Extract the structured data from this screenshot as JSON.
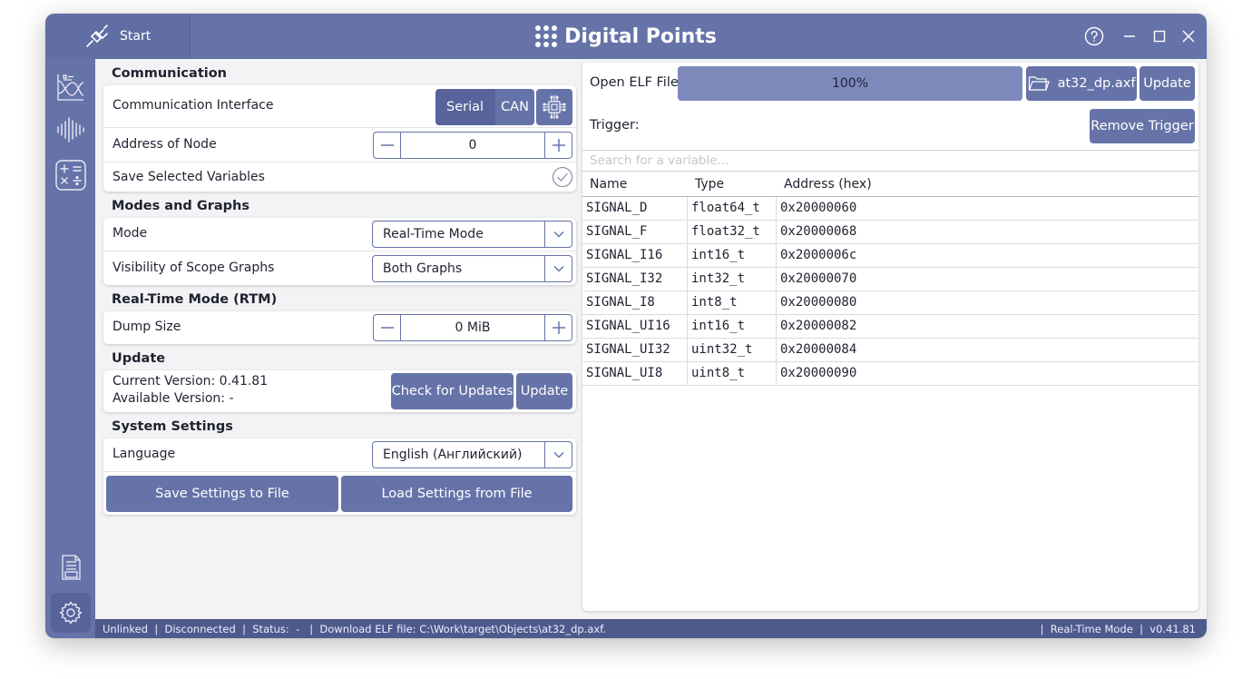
{
  "titlebar": {
    "start_label": "Start",
    "app_title": "Digital Points"
  },
  "communication": {
    "section_title": "Communication",
    "interface_label": "Communication Interface",
    "serial_label": "Serial",
    "can_label": "CAN",
    "node_label": "Address of Node",
    "node_value": "0",
    "save_vars_label": "Save Selected Variables"
  },
  "modes": {
    "section_title": "Modes and Graphs",
    "mode_label": "Mode",
    "mode_value": "Real-Time Mode",
    "visibility_label": "Visibility of Scope Graphs",
    "visibility_value": "Both Graphs"
  },
  "rtm": {
    "section_title": "Real-Time Mode (RTM)",
    "dump_label": "Dump Size",
    "dump_value": "0 MiB"
  },
  "update": {
    "section_title": "Update",
    "current_version": "Current Version: 0.41.81",
    "available_version": "Available Version:  -",
    "check_label": "Check for Updates",
    "update_label": "Update"
  },
  "system": {
    "section_title": "System Settings",
    "language_label": "Language",
    "language_value": "English (Английский)",
    "save_settings_label": "Save Settings to File",
    "load_settings_label": "Load Settings from File"
  },
  "elf": {
    "open_label": "Open ELF File",
    "progress_text": "100%",
    "progress_fraction": 1.0,
    "file_name": "at32_dp.axf",
    "update_label": "Update",
    "trigger_label": "Trigger:",
    "remove_trigger_label": "Remove Trigger",
    "search_placeholder": "Search for a variable...",
    "columns": [
      "Name",
      "Type",
      "Address (hex)"
    ],
    "rows": [
      [
        "SIGNAL_D",
        "float64_t",
        "0x20000060"
      ],
      [
        "SIGNAL_F",
        "float32_t",
        "0x20000068"
      ],
      [
        "SIGNAL_I16",
        "int16_t",
        "0x2000006c"
      ],
      [
        "SIGNAL_I32",
        "int32_t",
        "0x20000070"
      ],
      [
        "SIGNAL_I8",
        "int8_t",
        "0x20000080"
      ],
      [
        "SIGNAL_UI16",
        "int16_t",
        "0x20000082"
      ],
      [
        "SIGNAL_UI32",
        "uint32_t",
        "0x20000084"
      ],
      [
        "SIGNAL_UI8",
        "uint8_t",
        "0x20000090"
      ]
    ]
  },
  "statusbar": {
    "left": "Unlinked  |  Disconnected  |  Status:  -   |  Download ELF file: C:\\Work\\target\\Objects\\at32_dp.axf.",
    "right": "|  Real-Time Mode  |  v0.41.81"
  },
  "colors": {
    "accent": "#6673a8",
    "accent_dark": "#4e5a8c",
    "progress": "#7d89bb"
  },
  "icons": [
    "settings-icon",
    "help-icon",
    "minimize-icon",
    "maximize-icon",
    "close-icon",
    "graph-icon",
    "waveform-icon",
    "calculator-icon",
    "log-icon",
    "folder-icon",
    "check-circle-icon",
    "connector-icon",
    "chip-icon",
    "plus-icon",
    "minus-icon",
    "chevron-down-icon"
  ]
}
